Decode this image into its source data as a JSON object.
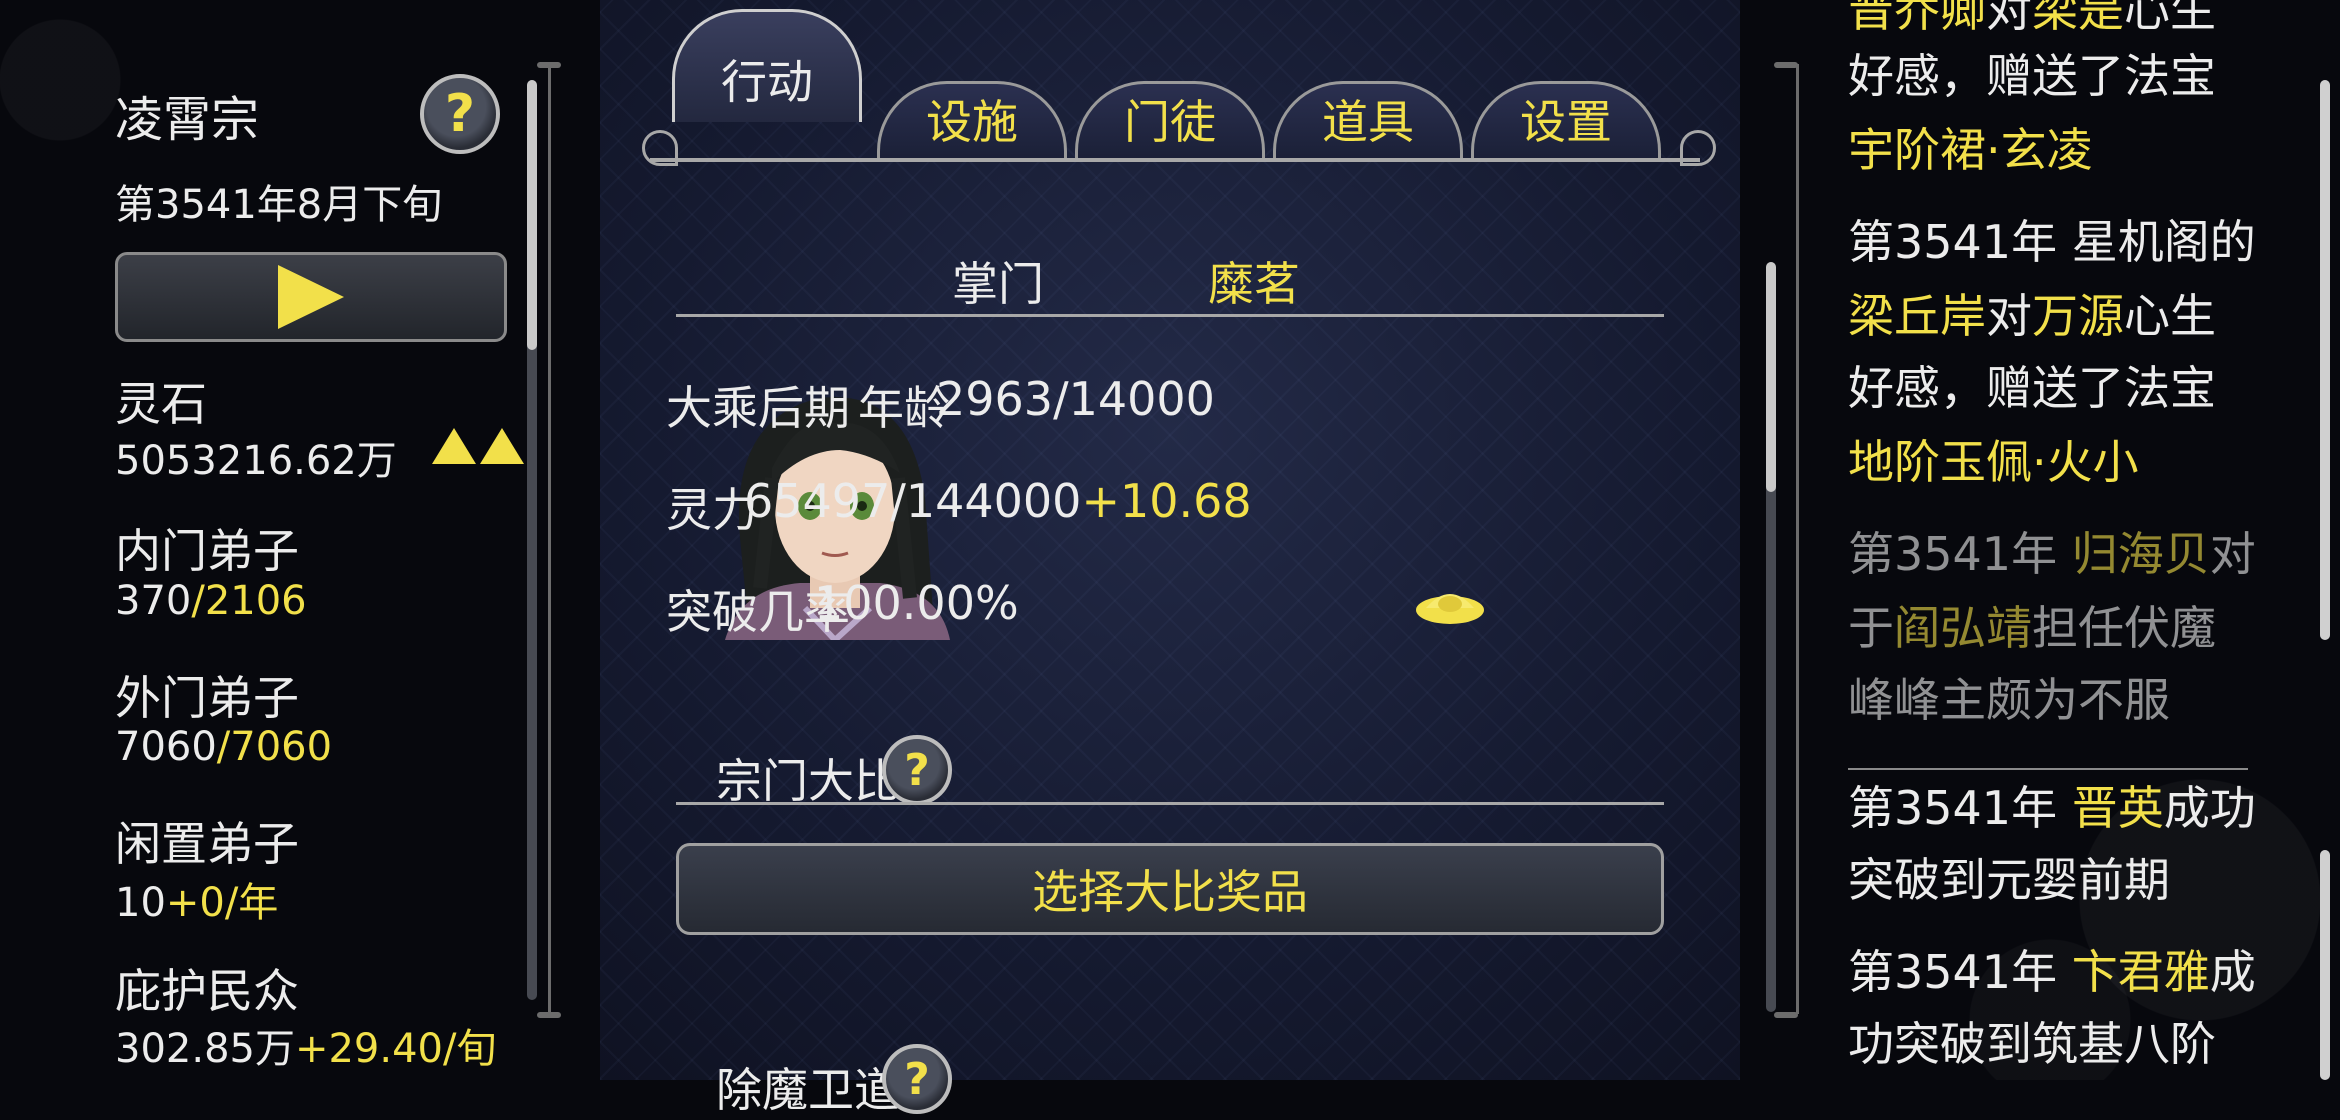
{
  "sidebar": {
    "sect_name": "凌霄宗",
    "date": "第3541年8月下旬",
    "spirit_stone_label": "灵石",
    "spirit_stone_value": "5053216.62万",
    "inner_disciples_label": "内门弟子",
    "inner_disciples_current": "370",
    "inner_disciples_max": "/2106",
    "outer_disciples_label": "外门弟子",
    "outer_disciples_current": "7060",
    "outer_disciples_max": "/7060",
    "idle_disciples_label": "闲置弟子",
    "idle_disciples_current": "10",
    "idle_disciples_rate": "+0/年",
    "protected_label": "庇护民众",
    "protected_current": "302.85万",
    "protected_rate": "+29.40/旬"
  },
  "tabs": [
    {
      "label": "行动",
      "active": true
    },
    {
      "label": "设施",
      "active": false
    },
    {
      "label": "门徒",
      "active": false
    },
    {
      "label": "道具",
      "active": false
    },
    {
      "label": "设置",
      "active": false
    }
  ],
  "leader": {
    "title_label": "掌门",
    "name": "糜茗",
    "realm": "大乘后期",
    "age_label": "年龄",
    "age_value": "2963/14000",
    "spirit_label": "灵力",
    "spirit_value": "65497/144000",
    "spirit_rate": "+10.68",
    "breakthrough_label": "突破几率",
    "breakthrough_value": "100.00%"
  },
  "competition": {
    "title": "宗门大比",
    "button": "选择大比奖品"
  },
  "next_section": {
    "title": "除魔卫道"
  },
  "log": {
    "e0_l0_a": "晋乔卿",
    "e0_l0_b": "对",
    "e0_l0_c": "梁是",
    "e0_l0_d": "心生",
    "e0_l1": "好感，赠送了法宝",
    "e0_l2": "宇阶裙·玄凌",
    "e1_l0_a": "第3541年 星机阁的",
    "e1_l1_a": "梁丘岸",
    "e1_l1_b": "对",
    "e1_l1_c": "万源",
    "e1_l1_d": "心生",
    "e1_l2": "好感，赠送了法宝",
    "e1_l3": "地阶玉佩·火小",
    "e2_l0_a": "第3541年 ",
    "e2_l0_b": "归海贝",
    "e2_l0_c": "对",
    "e2_l1_a": "于",
    "e2_l1_b": "阎弘靖",
    "e2_l1_c": "担任伏魔",
    "e2_l2": "峰峰主颇为不服",
    "e3_l0_a": "第3541年 ",
    "e3_l0_b": "晋英",
    "e3_l0_c": "成功",
    "e3_l1": "突破到元婴前期",
    "e4_l0_a": "第3541年 ",
    "e4_l0_b": "卞君雅",
    "e4_l0_c": "成",
    "e4_l1": "功突破到筑基八阶"
  },
  "colors": {
    "accent_yellow": "#f2e04a",
    "panel_bg": "#151a30",
    "page_bg": "#07080d"
  }
}
